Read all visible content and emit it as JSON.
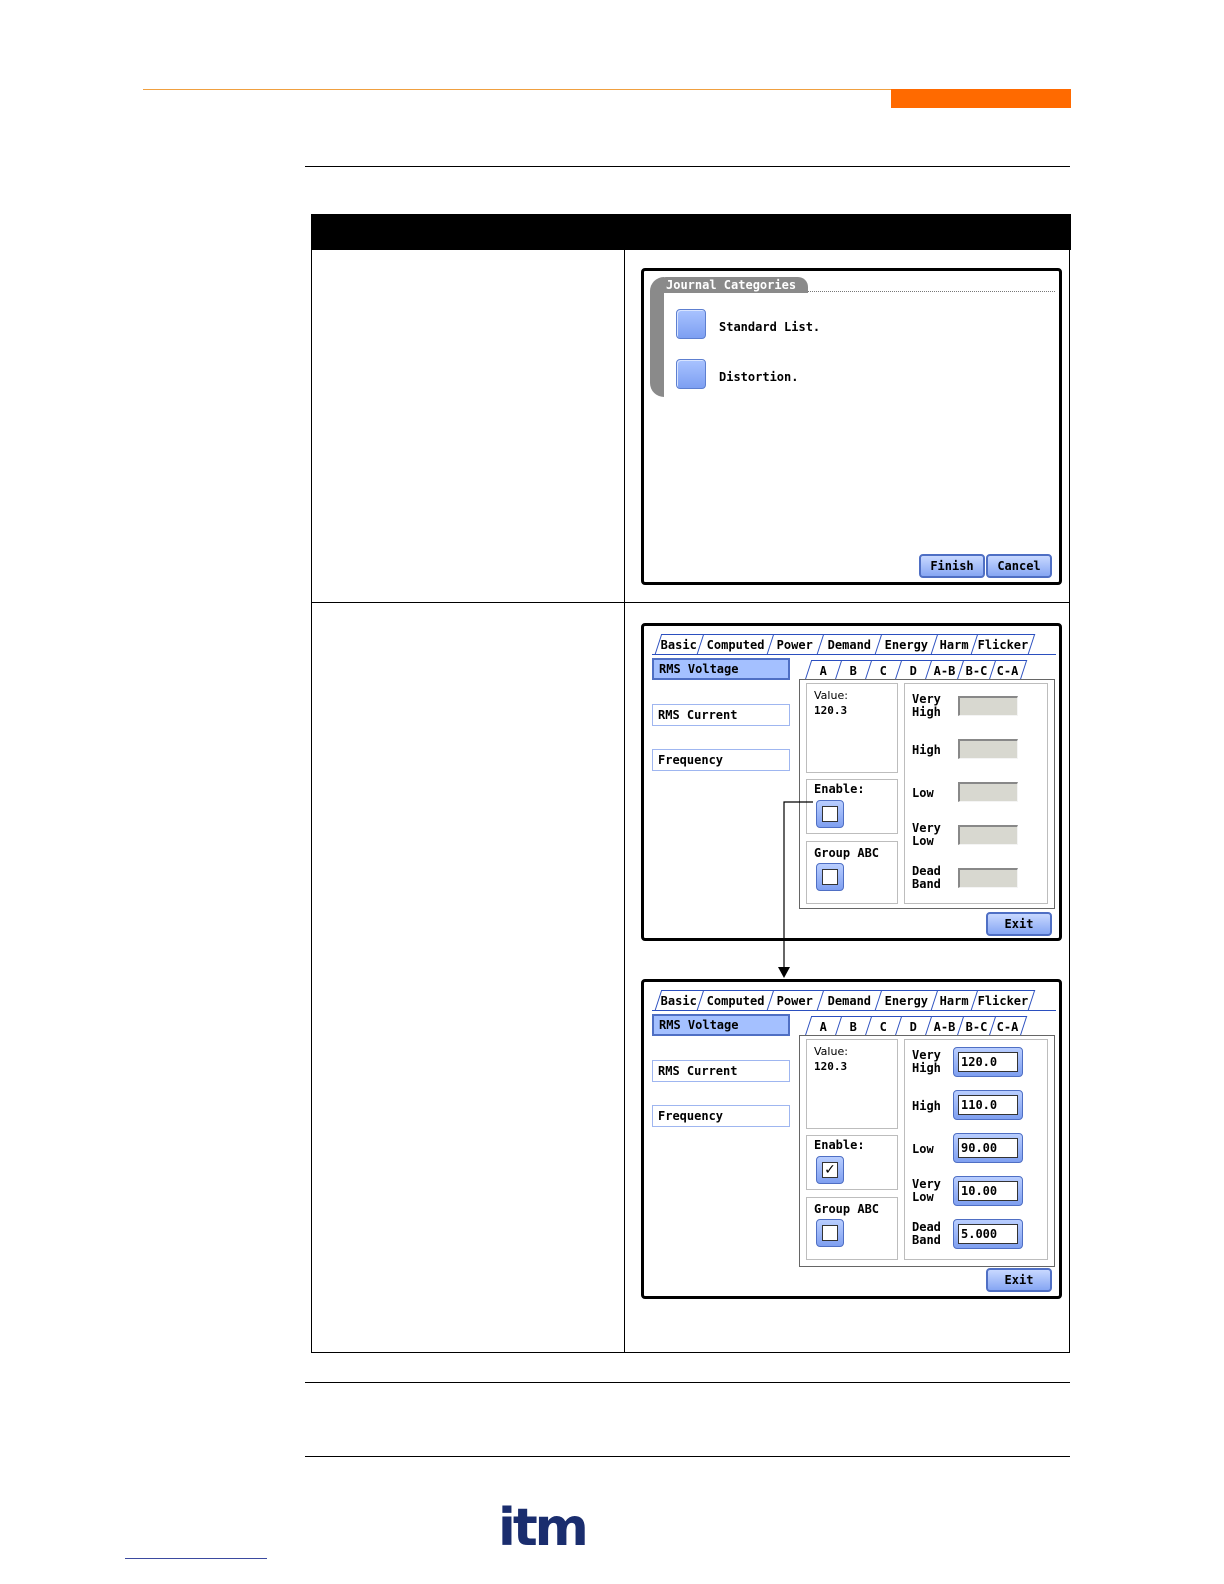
{
  "journal": {
    "group_title": "Journal Categories",
    "options": [
      "Standard List.",
      "Distortion."
    ],
    "finish_label": "Finish",
    "cancel_label": "Cancel"
  },
  "limits_before": {
    "tabs": [
      "Basic",
      "Computed",
      "Power",
      "Demand",
      "Energy",
      "Harm",
      "Flicker"
    ],
    "sub_tabs": [
      "A",
      "B",
      "C",
      "D",
      "A-B",
      "B-C",
      "C-A"
    ],
    "side_items": [
      "RMS Voltage",
      "RMS Current",
      "Frequency"
    ],
    "value_label": "Value:",
    "value": "120.3",
    "enable_label": "Enable:",
    "group_label": "Group ABC",
    "very_high_1": "Very",
    "very_high_2": "High",
    "high": "High",
    "low": "Low",
    "very_low_1": "Very",
    "very_low_2": "Low",
    "dead_band_1": "Dead",
    "dead_band_2": "Band",
    "exit_label": "Exit"
  },
  "limits_after": {
    "tabs": [
      "Basic",
      "Computed",
      "Power",
      "Demand",
      "Energy",
      "Harm",
      "Flicker"
    ],
    "sub_tabs": [
      "A",
      "B",
      "C",
      "D",
      "A-B",
      "B-C",
      "C-A"
    ],
    "side_items": [
      "RMS Voltage",
      "RMS Current",
      "Frequency"
    ],
    "value_label": "Value:",
    "value": "120.3",
    "enable_label": "Enable:",
    "enable_check": "✓",
    "group_label": "Group ABC",
    "very_high_1": "Very",
    "very_high_2": "High",
    "high": "High",
    "low": "Low",
    "very_low_1": "Very",
    "very_low_2": "Low",
    "dead_band_1": "Dead",
    "dead_band_2": "Band",
    "fields": [
      "120.0",
      "110.0",
      "90.00",
      "10.00",
      "5.000"
    ],
    "exit_label": "Exit"
  },
  "footer": {
    "logo_text": "itm"
  },
  "colors": {
    "accent_orange": "#ff6a00",
    "header_black": "#000000",
    "tab_blue": "#2b4fbf"
  }
}
